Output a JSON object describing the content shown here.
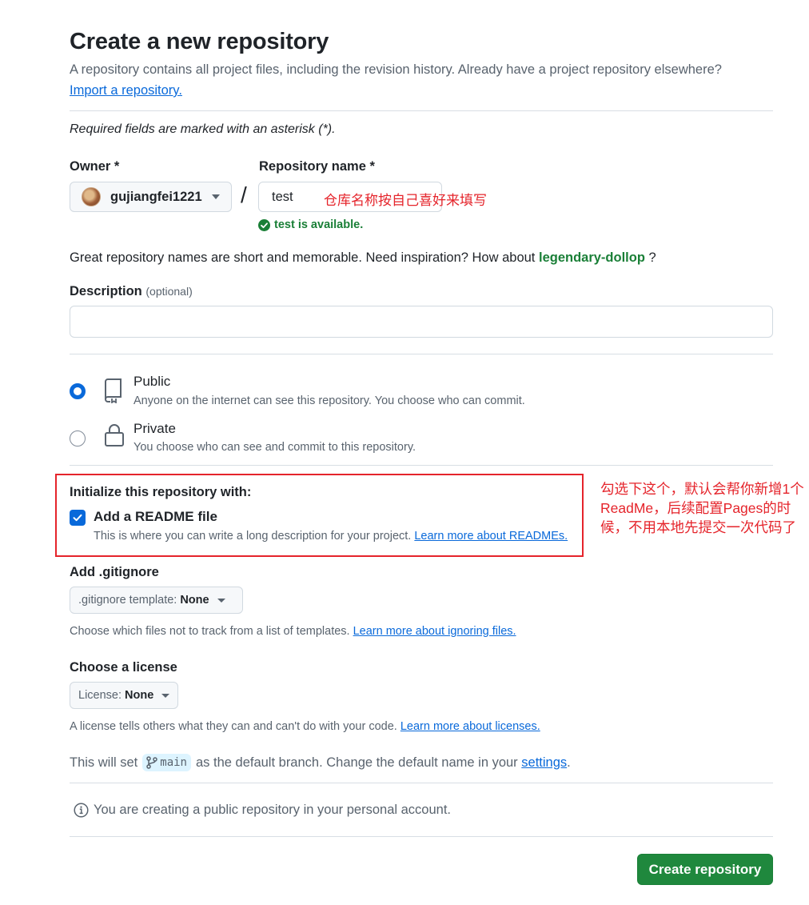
{
  "page": {
    "title": "Create a new repository",
    "subtitle": "A repository contains all project files, including the revision history. Already have a project repository elsewhere?",
    "import_link": "Import a repository.",
    "required_note": "Required fields are marked with an asterisk (*)."
  },
  "owner": {
    "label": "Owner *",
    "value": "gujiangfei1221"
  },
  "repository": {
    "label": "Repository name *",
    "value": "test",
    "annotation": "仓库名称按自己喜好来填写",
    "available": "test is available."
  },
  "names_hint": {
    "text": "Great repository names are short and memorable. Need inspiration? How about",
    "suggestion": "legendary-dollop",
    "suffix": "?"
  },
  "description": {
    "label": "Description",
    "optional": "(optional)",
    "value": ""
  },
  "visibility": {
    "public": {
      "title": "Public",
      "desc": "Anyone on the internet can see this repository. You choose who can commit.",
      "selected": true
    },
    "private": {
      "title": "Private",
      "desc": "You choose who can see and commit to this repository.",
      "selected": false
    }
  },
  "initialize": {
    "label": "Initialize this repository with:",
    "readme_title": "Add a README file",
    "readme_desc": "This is where you can write a long description for your project.",
    "readme_link": "Learn more about READMEs.",
    "readme_checked": true
  },
  "side_annotation": "勾选下这个，默认会帮你新增1个ReadMe，后续配置Pages的时候，不用本地先提交一次代码了",
  "gitignore": {
    "label": "Add .gitignore",
    "select_prefix": ".gitignore template:",
    "select_value": "None",
    "help": "Choose which files not to track from a list of templates.",
    "help_link": "Learn more about ignoring files."
  },
  "license": {
    "label": "Choose a license",
    "select_prefix": "License:",
    "select_value": "None",
    "help": "A license tells others what they can and can't do with your code.",
    "help_link": "Learn more about licenses."
  },
  "branch": {
    "prefix": "This will set",
    "name": "main",
    "middle": "as the default branch. Change the default name in your",
    "link": "settings",
    "suffix": "."
  },
  "info": {
    "text": "You are creating a public repository in your personal account."
  },
  "create_button": "Create repository",
  "colors": {
    "primary_button": "#1f883d",
    "link": "#0969da",
    "success": "#1a7f37",
    "annotation": "#e5242b"
  }
}
